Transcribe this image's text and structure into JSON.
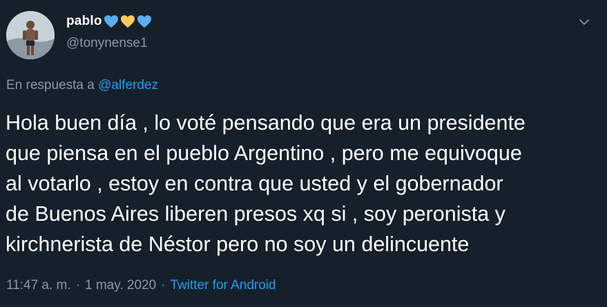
{
  "author": {
    "display_name": "pablo",
    "username": "@tonynense1",
    "hearts": [
      {
        "name": "blue-heart-icon",
        "color": "#5dadec"
      },
      {
        "name": "yellow-heart-icon",
        "color": "#fdcb58"
      },
      {
        "name": "blue-heart-icon",
        "color": "#5dadec"
      }
    ]
  },
  "reply": {
    "prefix": "En respuesta a",
    "mention": "@alferdez"
  },
  "tweet": {
    "lines": [
      "Hola buen día , lo voté pensando que era un presidente",
      "que piensa en el pueblo Argentino , pero me equivoque",
      "al votarlo , estoy en contra que usted y el gobernador",
      "de Buenos Aires liberen presos xq si , soy peronista y",
      "kirchnerista de Néstor pero no soy un delincuente"
    ]
  },
  "meta": {
    "time": "11:47 a. m.",
    "separator": "·",
    "date": "1 may. 2020",
    "source": "Twitter for Android"
  },
  "colors": {
    "background": "#15202b",
    "text": "#ffffff",
    "secondary": "#8899a6",
    "accent": "#1da1f2"
  },
  "icons": {
    "more": "chevron-down-icon"
  }
}
